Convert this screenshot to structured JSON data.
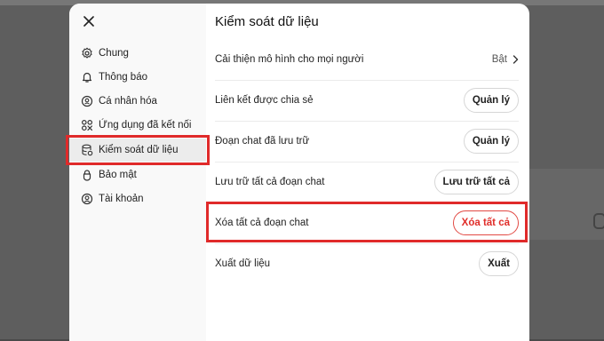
{
  "background": {
    "color": "#5e5e5e"
  },
  "modal": {
    "close_icon": "close-icon",
    "sidebar": {
      "items": [
        {
          "label": "Chung",
          "icon": "gear-icon"
        },
        {
          "label": "Thông báo",
          "icon": "bell-icon"
        },
        {
          "label": "Cá nhân hóa",
          "icon": "personalize-icon"
        },
        {
          "label": "Ứng dụng đã kết nối",
          "icon": "apps-grid-icon"
        },
        {
          "label": "Kiểm soát dữ liệu",
          "icon": "database-icon",
          "active": true
        },
        {
          "label": "Bảo mật",
          "icon": "lock-icon"
        },
        {
          "label": "Tài khoản",
          "icon": "user-icon"
        }
      ]
    },
    "content": {
      "title": "Kiểm soát dữ liệu",
      "rows": [
        {
          "label": "Cải thiện mô hình cho mọi người",
          "status": "Bật"
        },
        {
          "label": "Liên kết được chia sẻ",
          "button": "Quản lý"
        },
        {
          "label": "Đoạn chat đã lưu trữ",
          "button": "Quản lý"
        },
        {
          "label": "Lưu trữ tất cả đoạn chat",
          "button": "Lưu trữ tất cả"
        },
        {
          "label": "Xóa tất cả đoạn chat",
          "button": "Xóa tất cả"
        },
        {
          "label": "Xuất dữ liệu",
          "button": "Xuất"
        }
      ]
    }
  },
  "colors": {
    "danger": "#e02e2a",
    "highlight": "#e02a2a"
  }
}
